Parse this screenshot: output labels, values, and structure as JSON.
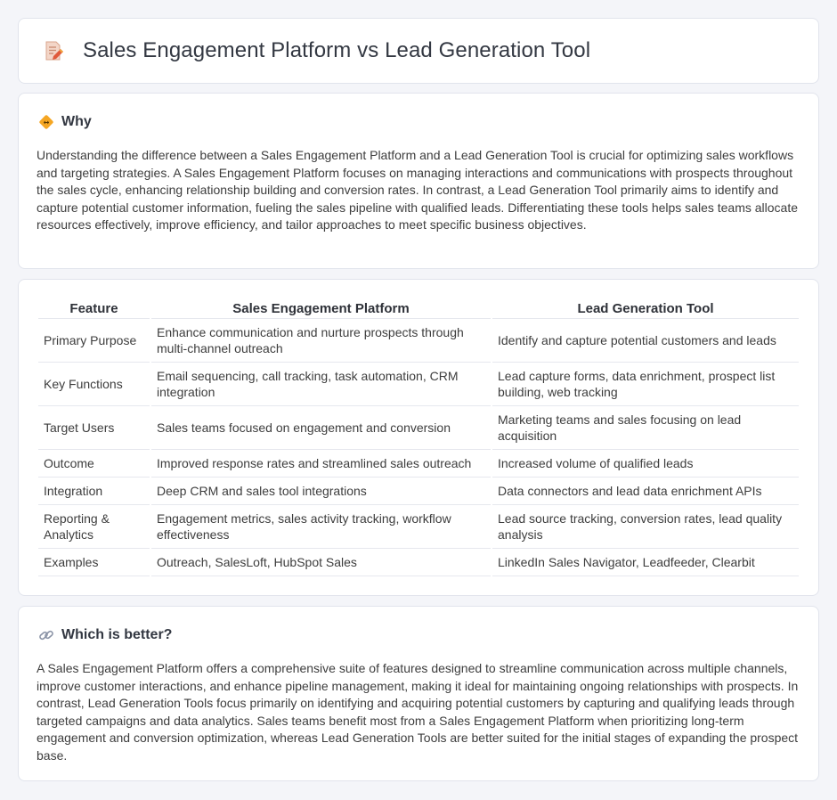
{
  "header": {
    "title": "Sales Engagement Platform vs Lead Generation Tool",
    "icon": "document-pencil-icon"
  },
  "why": {
    "heading": "Why",
    "icon": "diamond-sign-icon",
    "text": "Understanding the difference between a Sales Engagement Platform and a Lead Generation Tool is crucial for optimizing sales workflows and targeting strategies. A Sales Engagement Platform focuses on managing interactions and communications with prospects throughout the sales cycle, enhancing relationship building and conversion rates. In contrast, a Lead Generation Tool primarily aims to identify and capture potential customer information, fueling the sales pipeline with qualified leads. Differentiating these tools helps sales teams allocate resources effectively, improve efficiency, and tailor approaches to meet specific business objectives."
  },
  "table": {
    "headers": [
      "Feature",
      "Sales Engagement Platform",
      "Lead Generation Tool"
    ],
    "rows": [
      [
        "Primary Purpose",
        "Enhance communication and nurture prospects through multi-channel outreach",
        "Identify and capture potential customers and leads"
      ],
      [
        "Key Functions",
        "Email sequencing, call tracking, task automation, CRM integration",
        "Lead capture forms, data enrichment, prospect list building, web tracking"
      ],
      [
        "Target Users",
        "Sales teams focused on engagement and conversion",
        "Marketing teams and sales focusing on lead acquisition"
      ],
      [
        "Outcome",
        "Improved response rates and streamlined sales outreach",
        "Increased volume of qualified leads"
      ],
      [
        "Integration",
        "Deep CRM and sales tool integrations",
        "Data connectors and lead data enrichment APIs"
      ],
      [
        "Reporting & Analytics",
        "Engagement metrics, sales activity tracking, workflow effectiveness",
        "Lead source tracking, conversion rates, lead quality analysis"
      ],
      [
        "Examples",
        "Outreach, SalesLoft, HubSpot Sales",
        "LinkedIn Sales Navigator, Leadfeeder, Clearbit"
      ]
    ]
  },
  "better": {
    "heading": "Which is better?",
    "icon": "link-icon",
    "text": "A Sales Engagement Platform offers a comprehensive suite of features designed to streamline communication across multiple channels, improve customer interactions, and enhance pipeline management, making it ideal for maintaining ongoing relationships with prospects. In contrast, Lead Generation Tools focus primarily on identifying and acquiring potential customers by capturing and qualifying leads through targeted campaigns and data analytics. Sales teams benefit most from a Sales Engagement Platform when prioritizing long-term engagement and conversion optimization, whereas Lead Generation Tools are better suited for the initial stages of expanding the prospect base."
  }
}
